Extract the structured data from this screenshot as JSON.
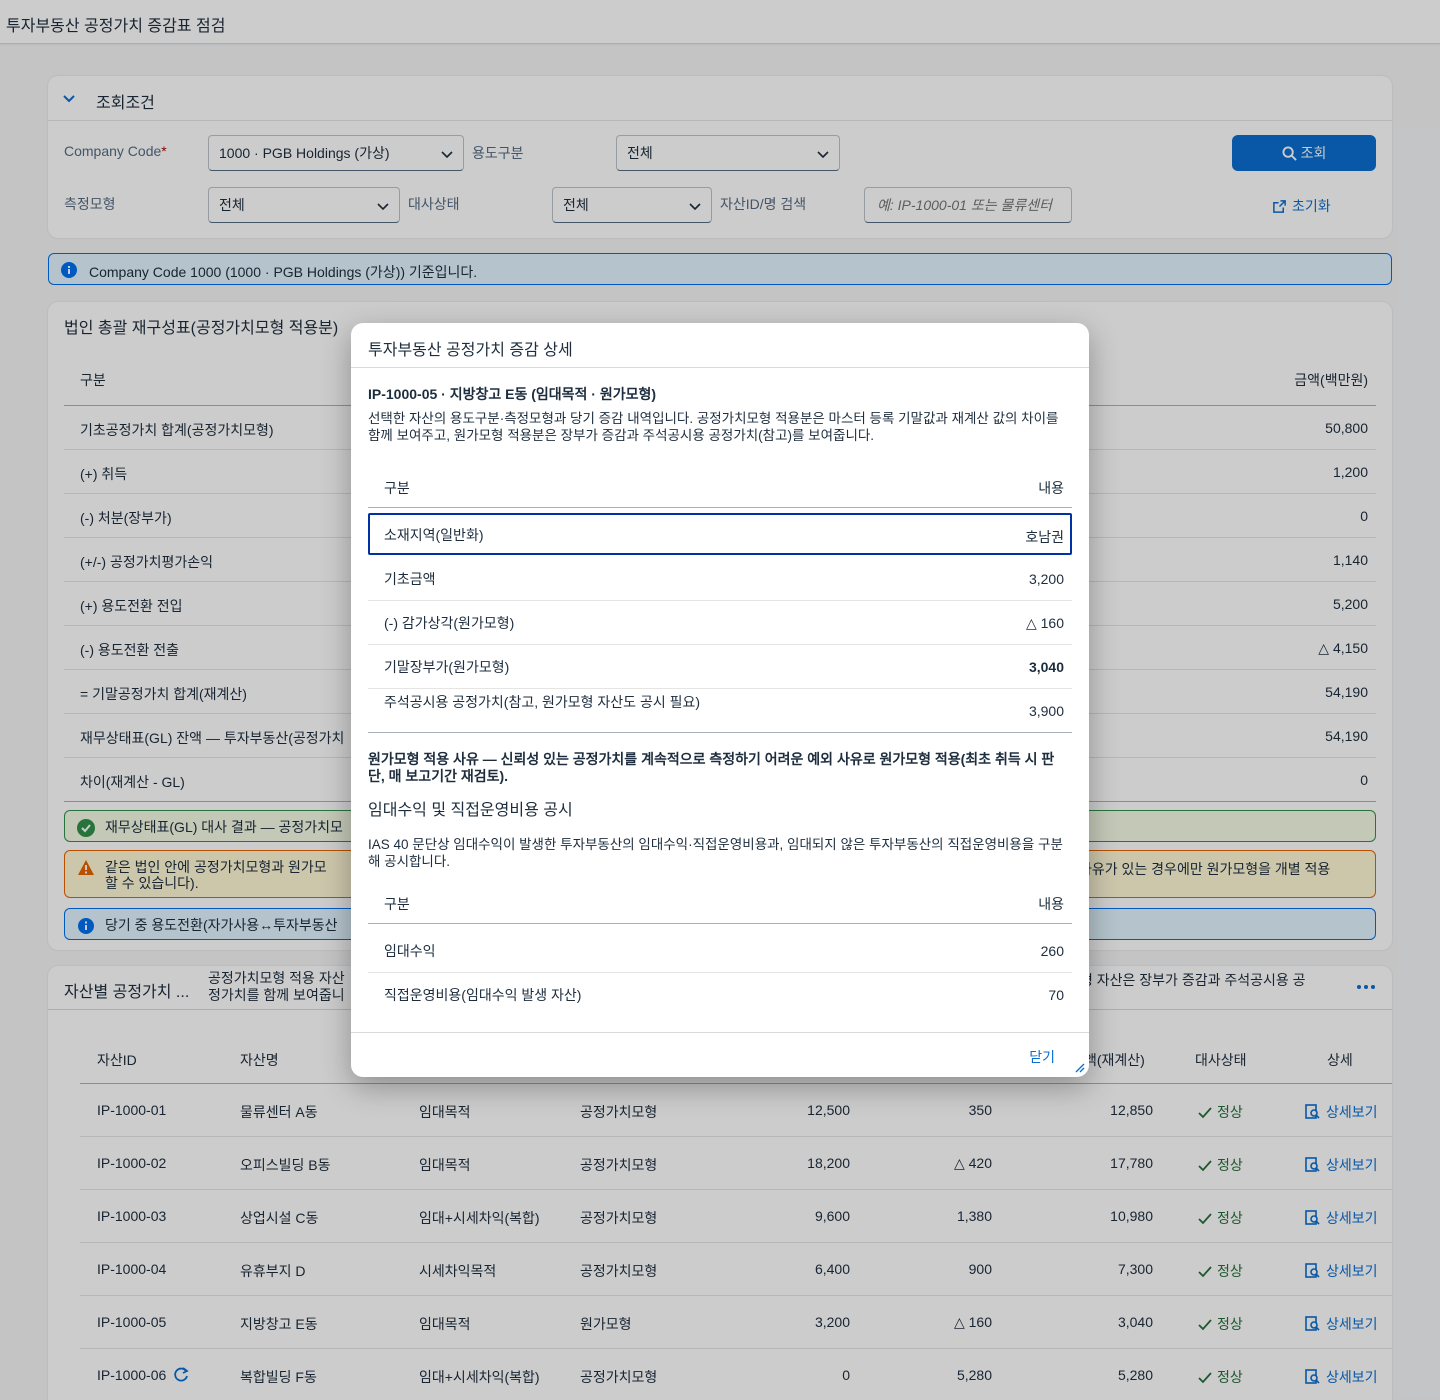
{
  "app": {
    "title": "투자부동산 공정가치 증감표 점검"
  },
  "filter": {
    "header": "조회조건",
    "company_code_label": "Company Code",
    "company_code_required": "*",
    "company_code_value": "1000 · PGB Holdings (가상)",
    "usage_label": "용도구분",
    "usage_value": "전체",
    "model_label": "측정모형",
    "model_value": "전체",
    "recon_label": "대사상태",
    "recon_value": "전체",
    "search_label": "자산ID/명 검색",
    "search_placeholder": "예: IP-1000-01 또는 물류센터",
    "search_button": "조회",
    "reset_button": "초기화"
  },
  "info_strip": "Company Code 1000 (1000 · PGB Holdings (가상)) 기준입니다.",
  "recon": {
    "title": "법인 총괄 재구성표(공정가치모형 적용분)",
    "col_label": "구분",
    "col_amount": "금액(백만원)",
    "rows": [
      {
        "label": "기초공정가치 합계(공정가치모형)",
        "value": "50,800"
      },
      {
        "label": "(+) 취득",
        "value": "1,200"
      },
      {
        "label": "(-) 처분(장부가)",
        "value": "0"
      },
      {
        "label": "(+/-) 공정가치평가손익",
        "value": "1,140"
      },
      {
        "label": "(+) 용도전환 전입",
        "value": "5,200"
      },
      {
        "label": "(-) 용도전환 전출",
        "value": "△ 4,150"
      },
      {
        "label": "= 기말공정가치 합계(재계산)",
        "value": "54,190"
      },
      {
        "label": "재무상태표(GL) 잔액 — 투자부동산(공정가치",
        "value": "54,190"
      },
      {
        "label": "차이(재계산 - GL)",
        "value": "0"
      }
    ],
    "msg_success": "재무상태표(GL) 대사 결과 — 공정가치모",
    "msg_warning_left": "같은 법인 안에 공정가치모형과 원가모",
    "msg_warning_left2": "할 수 있습니다).",
    "msg_warning_right": "사유가 있는 경우에만 원가모형을 개별 적용",
    "msg_info": "당기 중 용도전환(자가사용↔투자부동산"
  },
  "assets": {
    "title": "자산별 공정가치 ...",
    "desc_left": "공정가치모형 적용 자산",
    "desc_left2": "정가치를 함께 보여줍니",
    "desc_right": "형 자산은 장부가 증감과 주석공시용 공",
    "columns": {
      "id": "자산ID",
      "name": "자산명",
      "end": "액(재계산)",
      "status": "대사상태",
      "detail": "상세"
    },
    "rows": [
      {
        "id": "IP-1000-01",
        "name": "물류센터 A동",
        "usage": "임대목적",
        "model": "공정가치모형",
        "begin": "12,500",
        "change": "350",
        "end": "12,850",
        "status": "정상",
        "detail": "상세보기"
      },
      {
        "id": "IP-1000-02",
        "name": "오피스빌딩 B동",
        "usage": "임대목적",
        "model": "공정가치모형",
        "begin": "18,200",
        "change": "△ 420",
        "end": "17,780",
        "status": "정상",
        "detail": "상세보기"
      },
      {
        "id": "IP-1000-03",
        "name": "상업시설 C동",
        "usage": "임대+시세차익(복합)",
        "model": "공정가치모형",
        "begin": "9,600",
        "change": "1,380",
        "end": "10,980",
        "status": "정상",
        "detail": "상세보기"
      },
      {
        "id": "IP-1000-04",
        "name": "유휴부지 D",
        "usage": "시세차익목적",
        "model": "공정가치모형",
        "begin": "6,400",
        "change": "900",
        "end": "7,300",
        "status": "정상",
        "detail": "상세보기"
      },
      {
        "id": "IP-1000-05",
        "name": "지방창고 E동",
        "usage": "임대목적",
        "model": "원가모형",
        "begin": "3,200",
        "change": "△ 160",
        "end": "3,040",
        "status": "정상",
        "detail": "상세보기"
      },
      {
        "id": "IP-1000-06",
        "name": "복합빌딩 F동",
        "usage": "임대+시세차익(복합)",
        "model": "공정가치모형",
        "begin": "0",
        "change": "5,280",
        "end": "5,280",
        "status": "정상",
        "detail": "상세보기"
      }
    ]
  },
  "dialog": {
    "title": "투자부동산 공정가치 증감 상세",
    "heading": "IP-1000-05 · 지방창고 E동 (임대목적 · 원가모형)",
    "desc": "선택한 자산의 용도구분·측정모형과 당기 증감 내역입니다. 공정가치모형 적용분은 마스터 등록 기말값과 재계산 값의 차이를 함께 보여주고, 원가모형 적용분은 장부가 증감과 주석공시용 공정가치(참고)를 보여줍니다.",
    "col_label": "구분",
    "col_value": "내용",
    "rows": [
      {
        "label": "소재지역(일반화)",
        "value": "호남권"
      },
      {
        "label": "기초금액",
        "value": "3,200"
      },
      {
        "label": "(-) 감가상각(원가모형)",
        "value": "△ 160"
      },
      {
        "label": "기말장부가(원가모형)",
        "value": "3,040"
      },
      {
        "label": "주석공시용 공정가치(참고, 원가모형 자산도 공시 필요)",
        "value": "3,900"
      }
    ],
    "reason": "원가모형 적용 사유 — 신뢰성 있는 공정가치를 계속적으로 측정하기 어려운 예외 사유로 원가모형 적용(최초 취득 시 판단, 매 보고기간 재검토).",
    "sub_title": "임대수익 및 직접운영비용 공시",
    "sub_desc": "IAS 40 문단상 임대수익이 발생한 투자부동산의 임대수익·직접운영비용과, 임대되지 않은 투자부동산의 직접운영비용을 구분해 공시합니다.",
    "rows2": [
      {
        "label": "임대수익",
        "value": "260"
      },
      {
        "label": "직접운영비용(임대수익 발생 자산)",
        "value": "70"
      }
    ],
    "close": "닫기"
  },
  "colors": {
    "accent": "#0a6ed1",
    "success": "#256f3a",
    "warning": "#e76500",
    "info": "#0070f2"
  }
}
